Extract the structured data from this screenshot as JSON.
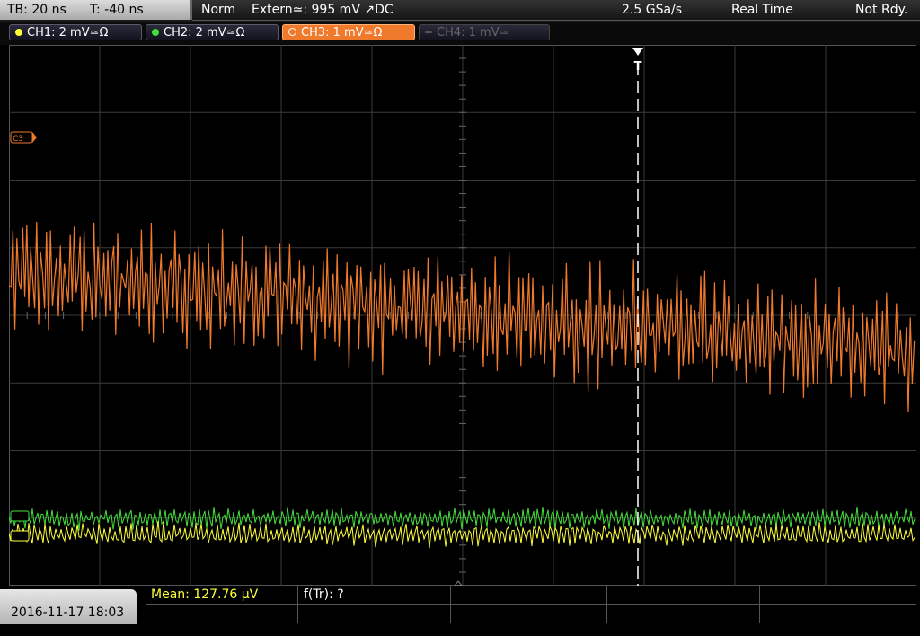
{
  "status": {
    "timebase": "TB: 20 ns",
    "trigger_time": "T: -40 ns",
    "mode": "Norm",
    "trigger_source": "Extern≃: 995 mV ↗DC",
    "sample_rate": "2.5 GSa/s",
    "acq_mode": "Real Time",
    "state": "Not Rdy."
  },
  "channels": [
    {
      "label": "CH1: 2 mV≃Ω",
      "color": "#ffff3c",
      "active": false,
      "enabled": true
    },
    {
      "label": "CH2: 2 mV≃Ω",
      "color": "#44e03a",
      "active": false,
      "enabled": true
    },
    {
      "label": "CH3: 1 mV≃Ω",
      "color": "#f07a2c",
      "active": true,
      "enabled": true
    },
    {
      "label": "CH4: 1 mV≃",
      "color": "#666666",
      "active": false,
      "enabled": false
    }
  ],
  "plot": {
    "ch3_marker": "C3",
    "trigger_marker": "T",
    "grid_color": "#3a3a3a"
  },
  "bottom": {
    "datetime": "2016-11-17 18:03",
    "mean": "Mean: 127.76 µV",
    "freq": "f(Tr): ?"
  },
  "colors": {
    "ch1": "#ffff3c",
    "ch2": "#44e03a",
    "ch3": "#f07a2c",
    "trigger_line": "#ffffff"
  }
}
